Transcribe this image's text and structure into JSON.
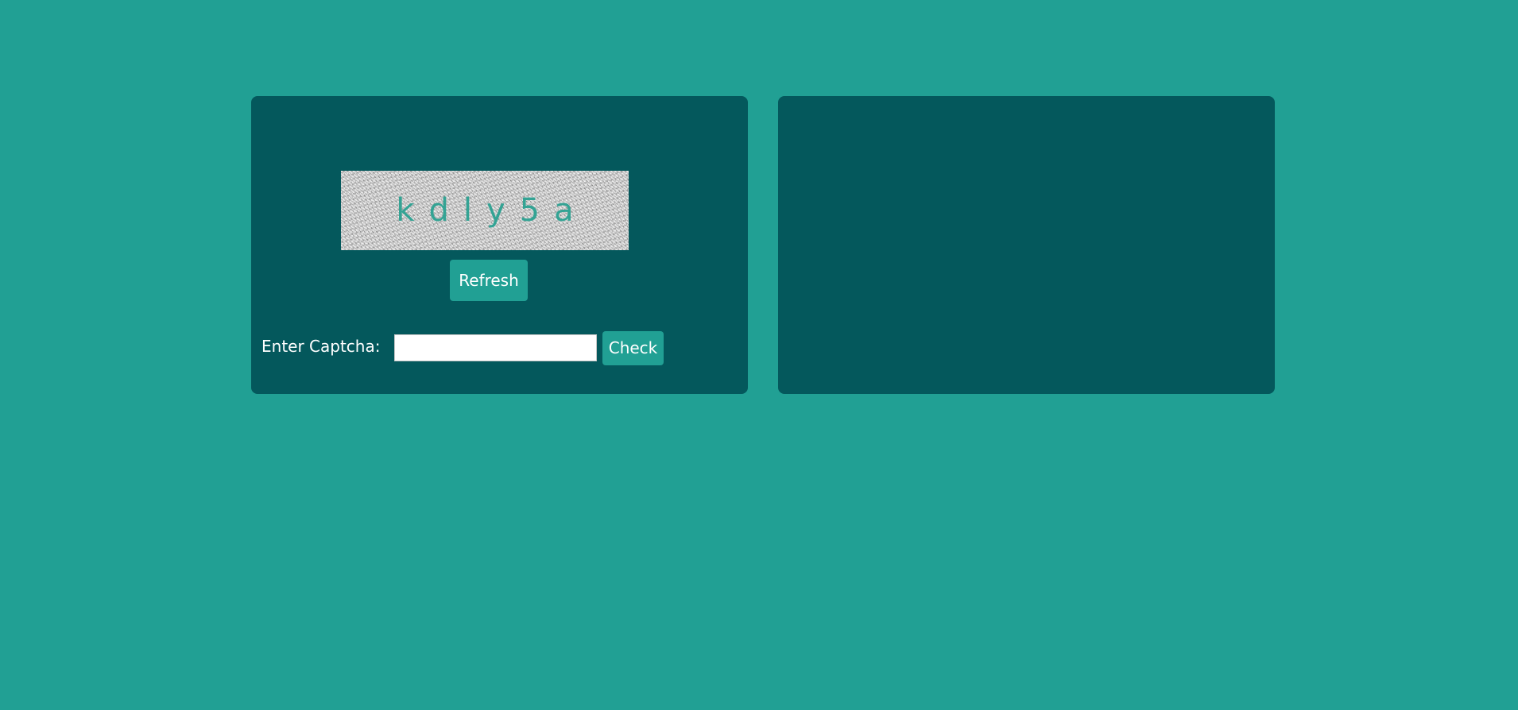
{
  "colors": {
    "page_background": "#21a094",
    "panel_background": "#04585c",
    "button_background": "#21a094",
    "button_text": "#ffffff",
    "captcha_text": "#34a394"
  },
  "captcha": {
    "text": "kdly5a",
    "refresh_label": "Refresh"
  },
  "form": {
    "label": "Enter Captcha:",
    "input_value": "",
    "check_label": "Check"
  },
  "result_panel": {}
}
